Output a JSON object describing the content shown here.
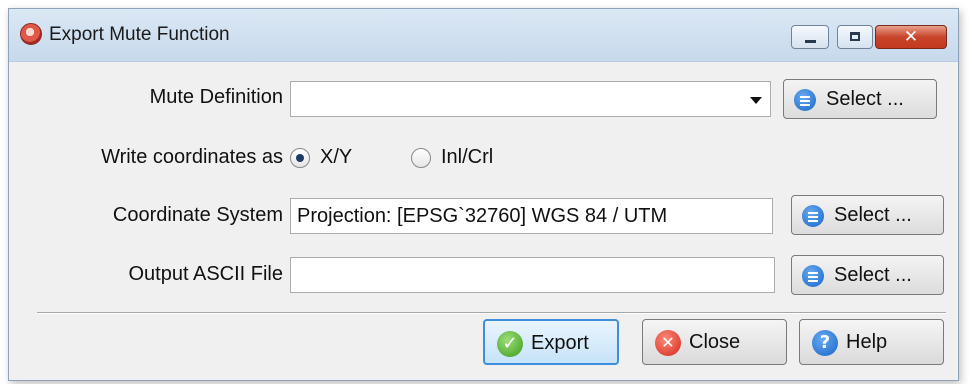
{
  "window": {
    "title": "Export Mute Function",
    "close_glyph": "✕"
  },
  "form": {
    "mute_definition": {
      "label": "Mute Definition",
      "value": "",
      "select_label": "Select ..."
    },
    "write_coordinates": {
      "label": "Write coordinates as",
      "options": [
        {
          "label": "X/Y",
          "checked": true
        },
        {
          "label": "Inl/Crl",
          "checked": false
        }
      ]
    },
    "coordinate_system": {
      "label": "Coordinate System",
      "value": "Projection: [EPSG`32760] WGS 84 / UTM",
      "select_label": "Select ..."
    },
    "output_ascii_file": {
      "label": "Output ASCII File",
      "value": "",
      "select_label": "Select ..."
    }
  },
  "footer": {
    "export_label": "Export",
    "close_label": "Close",
    "help_label": "Help"
  },
  "icons": {
    "app": "app-icon",
    "select": "list-icon",
    "export": "checkmark-icon",
    "close": "close-icon",
    "help": "help-icon"
  }
}
